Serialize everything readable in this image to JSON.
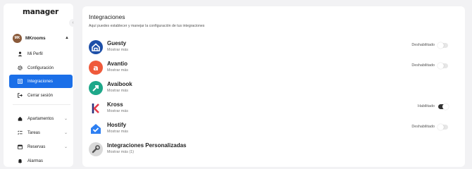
{
  "app": {
    "logo_text": "manager"
  },
  "sidebar": {
    "account": {
      "initials": "MK",
      "name": "MKrooms"
    },
    "top_items": [
      {
        "label": "Mi Perfil",
        "icon": "user-icon"
      },
      {
        "label": "Configuración",
        "icon": "gear-icon"
      },
      {
        "label": "Integraciones",
        "icon": "grid-icon",
        "active": true
      },
      {
        "label": "Cerrar sesión",
        "icon": "logout-icon"
      }
    ],
    "bottom_items": [
      {
        "label": "Apartamentos",
        "icon": "home-icon"
      },
      {
        "label": "Tareas",
        "icon": "tasks-icon"
      },
      {
        "label": "Reservas",
        "icon": "calendar-icon"
      },
      {
        "label": "Alarmas",
        "icon": "bell-icon"
      }
    ]
  },
  "main": {
    "title": "Integraciones",
    "subtitle": "Aquí puedes establecer y manejar la configuración de tus integraciones",
    "integrations": [
      {
        "name": "Guesty",
        "more": "Mostrar más",
        "status": "Deshabilitado",
        "enabled": false,
        "color": "#1d4fa8"
      },
      {
        "name": "Avantio",
        "more": "Mostrar más",
        "status": "Deshabilitado",
        "enabled": false,
        "color": "#ef5a3b"
      },
      {
        "name": "Avaibook",
        "more": "Mostrar más",
        "status": "",
        "enabled": null,
        "color": "#1ea88a"
      },
      {
        "name": "Kross",
        "more": "Mostrar más",
        "status": "Habilitado",
        "enabled": true,
        "color": "#2a2f7a"
      },
      {
        "name": "Hostify",
        "more": "Mostrar más",
        "status": "Deshabilitado",
        "enabled": false,
        "color": "#2d7ff2"
      },
      {
        "name": "Integraciones Personalizadas",
        "more": "Mostrar más (1)",
        "status": "",
        "enabled": null,
        "color": "#666666"
      }
    ]
  },
  "colors": {
    "accent": "#1b6fe8",
    "toggle_on": "#333333",
    "toggle_off": "#e6e6e6"
  }
}
